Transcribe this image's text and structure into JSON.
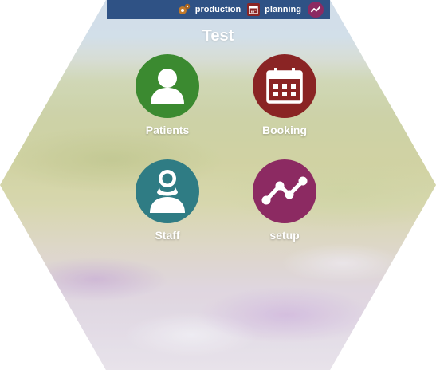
{
  "topbar": {
    "items": [
      {
        "label": "production",
        "icon": "gears-icon"
      },
      {
        "label": "planning",
        "icon": "calendar-icon"
      },
      {
        "label": "",
        "icon": "trend-icon"
      }
    ]
  },
  "page": {
    "title": "Test"
  },
  "tiles": [
    {
      "label": "Patients",
      "icon": "person-icon",
      "color": "#3b8a30"
    },
    {
      "label": "Booking",
      "icon": "calendar-icon",
      "color": "#8a2424"
    },
    {
      "label": "Staff",
      "icon": "staff-person-icon",
      "color": "#2f7c84"
    },
    {
      "label": "setup",
      "icon": "trend-line-icon",
      "color": "#8c2a62"
    }
  ],
  "colors": {
    "topbar": "#2f5285",
    "text": "#ffffff"
  }
}
